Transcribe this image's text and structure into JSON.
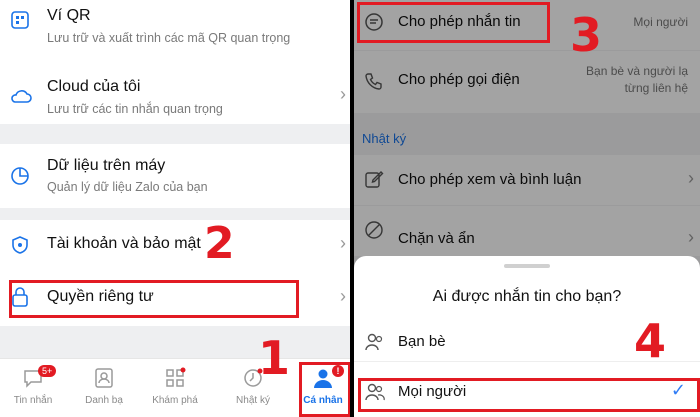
{
  "left_panel": {
    "items": [
      {
        "title": "Ví QR",
        "subtitle": "Lưu trữ và xuất trình các mã QR quan trọng"
      },
      {
        "title": "Cloud của tôi",
        "subtitle": "Lưu trữ các tin nhắn quan trọng"
      },
      {
        "title": "Dữ liệu trên máy",
        "subtitle": "Quản lý dữ liệu Zalo của bạn"
      },
      {
        "title": "Tài khoản và bảo mật",
        "subtitle": ""
      },
      {
        "title": "Quyền riêng tư",
        "subtitle": ""
      }
    ],
    "bottom_nav": [
      {
        "label": "Tin nhắn",
        "badge": "5+"
      },
      {
        "label": "Danh bạ",
        "badge": ""
      },
      {
        "label": "Khám phá",
        "badge": ""
      },
      {
        "label": "Nhật ký",
        "badge": ""
      },
      {
        "label": "Cá nhân",
        "badge": "!"
      }
    ]
  },
  "right_panel": {
    "rows": [
      {
        "title": "Cho phép nhắn tin",
        "value": "Mọi người"
      },
      {
        "title": "Cho phép gọi điện",
        "value": "Bạn bè và người lạ từng liên hệ"
      }
    ],
    "section_header": "Nhật ký",
    "rows2": [
      {
        "title": "Cho phép xem và bình luận"
      },
      {
        "title": "Chặn và ẩn"
      }
    ],
    "sheet": {
      "title": "Ai được nhắn tin cho bạn?",
      "options": [
        {
          "label": "Bạn bè"
        },
        {
          "label": "Mọi người"
        }
      ]
    }
  },
  "step_numbers": [
    "1",
    "2",
    "3",
    "4"
  ],
  "colors": {
    "highlight": "#e21b23",
    "accent_blue": "#2f7cf6",
    "zalo_blue": "#1a73e8"
  }
}
